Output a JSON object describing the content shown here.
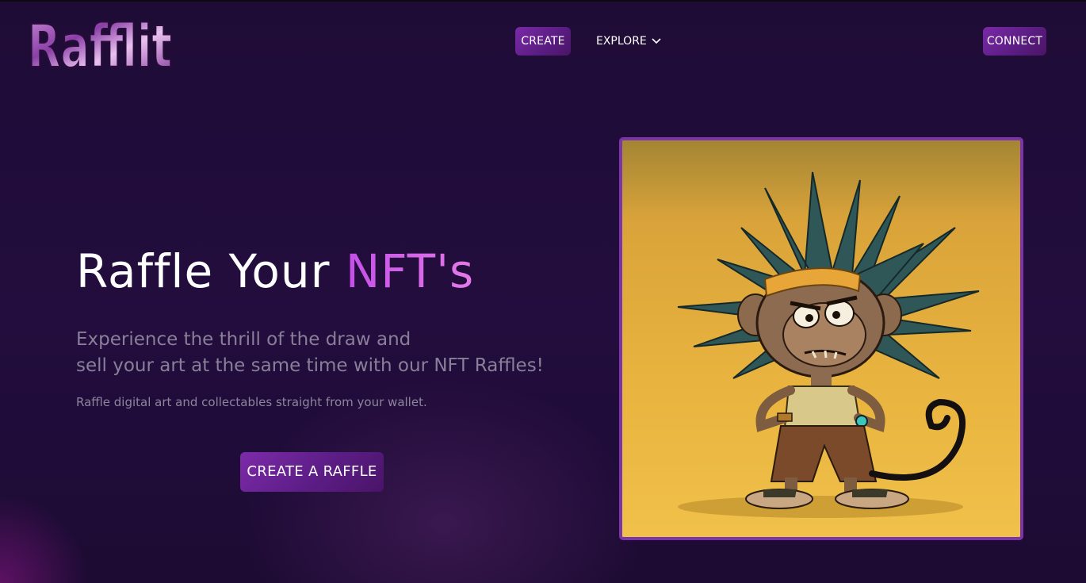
{
  "brand": {
    "logo_text": "Rafflit"
  },
  "nav": {
    "create_label": "CREATE",
    "explore_label": "EXPLORE",
    "explore_icon": "chevron-down-icon",
    "connect_label": "CONNECT"
  },
  "hero": {
    "title_prefix": "Raffle Your",
    "title_accent": "NFT's",
    "subtitle_line1": "Experience the thrill of the draw and",
    "subtitle_line2": "sell your art at the same time with our NFT Raffles!",
    "small_text": "Raffle digital art and collectables straight from your wallet.",
    "cta_label": "CREATE A RAFFLE"
  },
  "colors": {
    "background": "#220d3e",
    "button": "#6a2396",
    "accent": "#d35ee8",
    "frame_border": "#7b35a8",
    "art_background": "#e8b33e"
  }
}
